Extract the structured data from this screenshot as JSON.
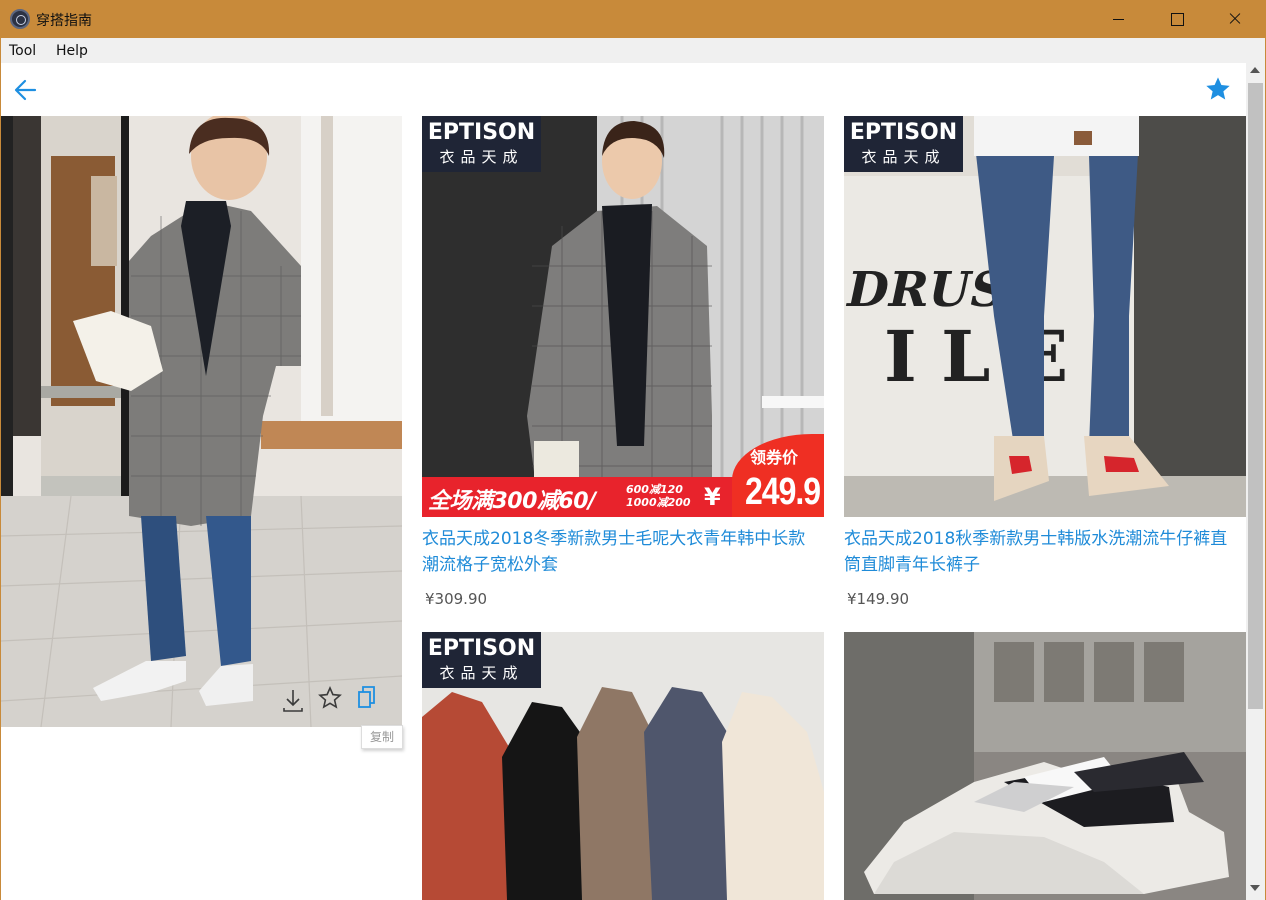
{
  "window": {
    "title": "穿搭指南",
    "icon": "app-logo-icon"
  },
  "menu": {
    "tool": "Tool",
    "help": "Help"
  },
  "toolbar": {
    "back_icon": "arrow-left-icon",
    "favorite_icon": "star-filled-icon"
  },
  "colors": {
    "titlebar": "#c88a3a",
    "accent": "#1e8fe1",
    "link": "#1f8bd8",
    "promo_red": "#e8232c",
    "brand_tag": "#1f2536"
  },
  "main_photo": {
    "actions": [
      {
        "icon": "download-icon"
      },
      {
        "icon": "star-outline-icon"
      },
      {
        "icon": "copy-icon"
      }
    ],
    "tooltip": "复制"
  },
  "products": [
    {
      "brand_en": "EPTISON",
      "brand_cn": "衣品天成",
      "promo": {
        "main": "全场满300减60/",
        "sub1": "600减120",
        "sub2": "1000减200",
        "yen": "¥",
        "label": "领券价",
        "price": "249.9"
      },
      "title": "衣品天成2018冬季新款男士毛呢大衣青年韩中长款潮流格子宽松外套",
      "price": "¥309.90"
    },
    {
      "brand_en": "EPTISON",
      "brand_cn": "衣品天成",
      "title": "衣品天成2018秋季新款男士韩版水洗潮流牛仔裤直筒直脚青年长裤子",
      "price": "¥149.90"
    },
    {
      "brand_en": "EPTISON",
      "brand_cn": "衣品天成"
    },
    {}
  ]
}
